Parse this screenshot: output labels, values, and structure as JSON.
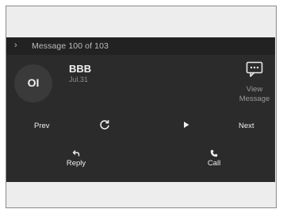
{
  "header": {
    "chevron_icon": "chevron-right-icon",
    "title": "Message 100 of 103"
  },
  "message": {
    "avatar_initials": "OI",
    "sender": "BBB",
    "date": "Jul.31"
  },
  "view_message": {
    "icon": "message-bubble-icon",
    "label_line1": "View",
    "label_line2": "Message"
  },
  "controls": {
    "prev_label": "Prev",
    "repeat_icon": "refresh-icon",
    "play_icon": "play-icon",
    "next_label": "Next"
  },
  "actions": {
    "reply_label": "Reply",
    "reply_icon": "reply-arrow-icon",
    "call_label": "Call",
    "call_icon": "phone-icon"
  },
  "colors": {
    "screen_bg": "#2b2b2b",
    "frame_bg": "#ededed",
    "text_primary": "#efefef",
    "text_muted": "#9a9a9a"
  }
}
